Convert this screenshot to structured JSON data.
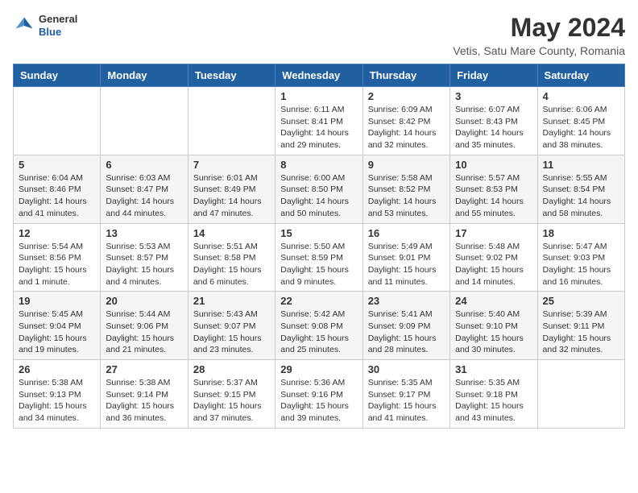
{
  "logo": {
    "general": "General",
    "blue": "Blue"
  },
  "header": {
    "title": "May 2024",
    "subtitle": "Vetis, Satu Mare County, Romania"
  },
  "weekdays": [
    "Sunday",
    "Monday",
    "Tuesday",
    "Wednesday",
    "Thursday",
    "Friday",
    "Saturday"
  ],
  "weeks": [
    [
      {
        "day": "",
        "info": ""
      },
      {
        "day": "",
        "info": ""
      },
      {
        "day": "",
        "info": ""
      },
      {
        "day": "1",
        "info": "Sunrise: 6:11 AM\nSunset: 8:41 PM\nDaylight: 14 hours\nand 29 minutes."
      },
      {
        "day": "2",
        "info": "Sunrise: 6:09 AM\nSunset: 8:42 PM\nDaylight: 14 hours\nand 32 minutes."
      },
      {
        "day": "3",
        "info": "Sunrise: 6:07 AM\nSunset: 8:43 PM\nDaylight: 14 hours\nand 35 minutes."
      },
      {
        "day": "4",
        "info": "Sunrise: 6:06 AM\nSunset: 8:45 PM\nDaylight: 14 hours\nand 38 minutes."
      }
    ],
    [
      {
        "day": "5",
        "info": "Sunrise: 6:04 AM\nSunset: 8:46 PM\nDaylight: 14 hours\nand 41 minutes."
      },
      {
        "day": "6",
        "info": "Sunrise: 6:03 AM\nSunset: 8:47 PM\nDaylight: 14 hours\nand 44 minutes."
      },
      {
        "day": "7",
        "info": "Sunrise: 6:01 AM\nSunset: 8:49 PM\nDaylight: 14 hours\nand 47 minutes."
      },
      {
        "day": "8",
        "info": "Sunrise: 6:00 AM\nSunset: 8:50 PM\nDaylight: 14 hours\nand 50 minutes."
      },
      {
        "day": "9",
        "info": "Sunrise: 5:58 AM\nSunset: 8:52 PM\nDaylight: 14 hours\nand 53 minutes."
      },
      {
        "day": "10",
        "info": "Sunrise: 5:57 AM\nSunset: 8:53 PM\nDaylight: 14 hours\nand 55 minutes."
      },
      {
        "day": "11",
        "info": "Sunrise: 5:55 AM\nSunset: 8:54 PM\nDaylight: 14 hours\nand 58 minutes."
      }
    ],
    [
      {
        "day": "12",
        "info": "Sunrise: 5:54 AM\nSunset: 8:56 PM\nDaylight: 15 hours\nand 1 minute."
      },
      {
        "day": "13",
        "info": "Sunrise: 5:53 AM\nSunset: 8:57 PM\nDaylight: 15 hours\nand 4 minutes."
      },
      {
        "day": "14",
        "info": "Sunrise: 5:51 AM\nSunset: 8:58 PM\nDaylight: 15 hours\nand 6 minutes."
      },
      {
        "day": "15",
        "info": "Sunrise: 5:50 AM\nSunset: 8:59 PM\nDaylight: 15 hours\nand 9 minutes."
      },
      {
        "day": "16",
        "info": "Sunrise: 5:49 AM\nSunset: 9:01 PM\nDaylight: 15 hours\nand 11 minutes."
      },
      {
        "day": "17",
        "info": "Sunrise: 5:48 AM\nSunset: 9:02 PM\nDaylight: 15 hours\nand 14 minutes."
      },
      {
        "day": "18",
        "info": "Sunrise: 5:47 AM\nSunset: 9:03 PM\nDaylight: 15 hours\nand 16 minutes."
      }
    ],
    [
      {
        "day": "19",
        "info": "Sunrise: 5:45 AM\nSunset: 9:04 PM\nDaylight: 15 hours\nand 19 minutes."
      },
      {
        "day": "20",
        "info": "Sunrise: 5:44 AM\nSunset: 9:06 PM\nDaylight: 15 hours\nand 21 minutes."
      },
      {
        "day": "21",
        "info": "Sunrise: 5:43 AM\nSunset: 9:07 PM\nDaylight: 15 hours\nand 23 minutes."
      },
      {
        "day": "22",
        "info": "Sunrise: 5:42 AM\nSunset: 9:08 PM\nDaylight: 15 hours\nand 25 minutes."
      },
      {
        "day": "23",
        "info": "Sunrise: 5:41 AM\nSunset: 9:09 PM\nDaylight: 15 hours\nand 28 minutes."
      },
      {
        "day": "24",
        "info": "Sunrise: 5:40 AM\nSunset: 9:10 PM\nDaylight: 15 hours\nand 30 minutes."
      },
      {
        "day": "25",
        "info": "Sunrise: 5:39 AM\nSunset: 9:11 PM\nDaylight: 15 hours\nand 32 minutes."
      }
    ],
    [
      {
        "day": "26",
        "info": "Sunrise: 5:38 AM\nSunset: 9:13 PM\nDaylight: 15 hours\nand 34 minutes."
      },
      {
        "day": "27",
        "info": "Sunrise: 5:38 AM\nSunset: 9:14 PM\nDaylight: 15 hours\nand 36 minutes."
      },
      {
        "day": "28",
        "info": "Sunrise: 5:37 AM\nSunset: 9:15 PM\nDaylight: 15 hours\nand 37 minutes."
      },
      {
        "day": "29",
        "info": "Sunrise: 5:36 AM\nSunset: 9:16 PM\nDaylight: 15 hours\nand 39 minutes."
      },
      {
        "day": "30",
        "info": "Sunrise: 5:35 AM\nSunset: 9:17 PM\nDaylight: 15 hours\nand 41 minutes."
      },
      {
        "day": "31",
        "info": "Sunrise: 5:35 AM\nSunset: 9:18 PM\nDaylight: 15 hours\nand 43 minutes."
      },
      {
        "day": "",
        "info": ""
      }
    ]
  ]
}
